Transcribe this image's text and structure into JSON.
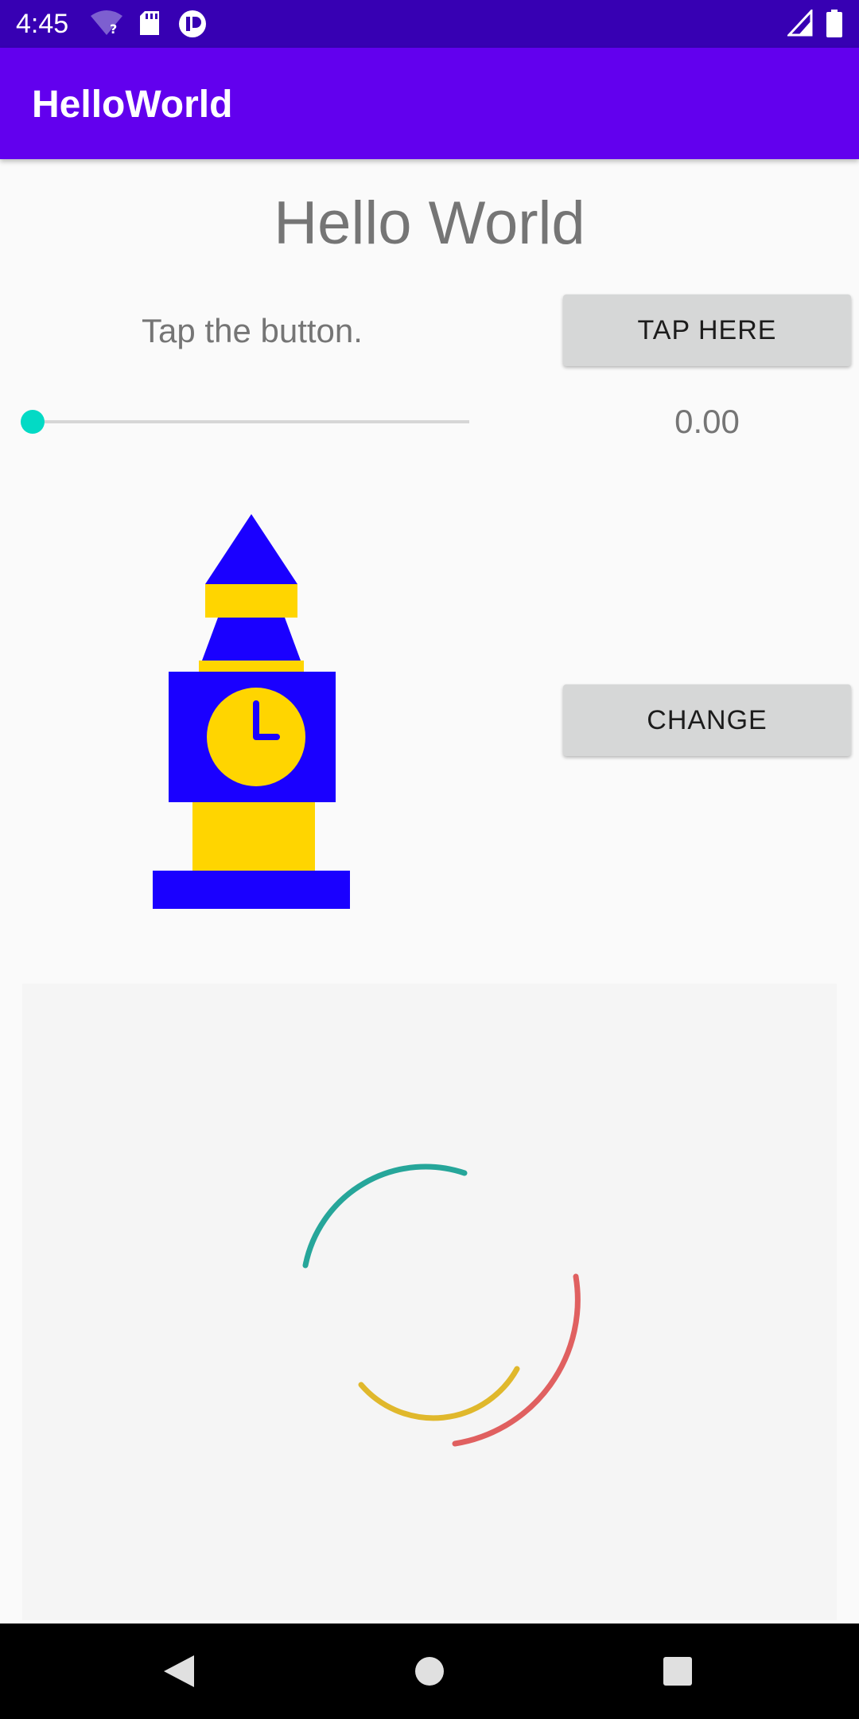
{
  "status_bar": {
    "time": "4:45",
    "icons": [
      "wifi-unknown-icon",
      "sd-card-icon",
      "app-notification-icon",
      "cell-signal-icon",
      "battery-icon"
    ],
    "background": "#3700b3"
  },
  "app_bar": {
    "title": "HelloWorld",
    "background": "#6200ee"
  },
  "main": {
    "greeting": "Hello World",
    "prompt": "Tap the button.",
    "tap_button_label": "TAP HERE",
    "slider": {
      "value_text": "0.00",
      "fraction": 0.0,
      "accent_color": "#03dac5"
    },
    "change_button_label": "CHANGE",
    "tower_image": {
      "description_icon": "clock-tower-icon",
      "primary_color": "#1a00ff",
      "secondary_color": "#ffd500"
    },
    "spinner": {
      "icon": "loading-spinner-icon",
      "colors": [
        "#26a69a",
        "#e06060",
        "#e0b82c"
      ]
    }
  },
  "nav_bar": {
    "icons": [
      "back-icon",
      "home-icon",
      "recents-icon"
    ]
  }
}
